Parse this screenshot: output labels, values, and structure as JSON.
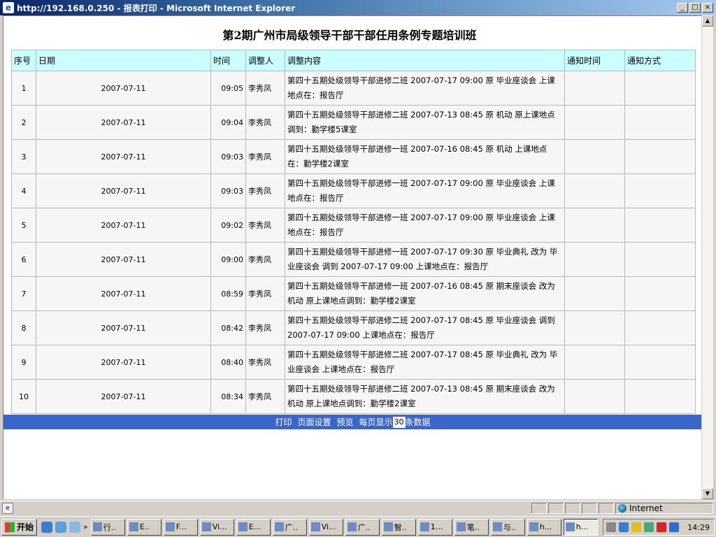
{
  "window": {
    "title": "http://192.168.0.250 - 报表打印 - Microsoft Internet Explorer",
    "min_glyph": "_",
    "max_glyph": "□",
    "close_glyph": "×"
  },
  "report": {
    "title": "第2期广州市局级领导干部干部任用条例专题培训班",
    "columns": [
      "序号",
      "日期",
      "时间",
      "调整人",
      "调整内容",
      "通知时间",
      "通知方式"
    ],
    "rows": [
      {
        "no": "1",
        "date": "2007-07-11",
        "time": "09:05",
        "person": "李秀凤",
        "content": "第四十五期处级领导干部进修二班 2007-07-17 09:00 原 毕业座谈会 上课地点在：报告厅",
        "notify_time": "",
        "notify_method": ""
      },
      {
        "no": "2",
        "date": "2007-07-11",
        "time": "09:04",
        "person": "李秀凤",
        "content": "第四十五期处级领导干部进修二班 2007-07-13 08:45 原 机动 原上课地点调到：勤学楼5课室",
        "notify_time": "",
        "notify_method": ""
      },
      {
        "no": "3",
        "date": "2007-07-11",
        "time": "09:03",
        "person": "李秀凤",
        "content": "第四十五期处级领导干部进修一班 2007-07-16 08:45 原 机动 上课地点在：勤学楼2课室",
        "notify_time": "",
        "notify_method": ""
      },
      {
        "no": "4",
        "date": "2007-07-11",
        "time": "09:03",
        "person": "李秀凤",
        "content": "第四十五期处级领导干部进修一班 2007-07-17 09:00 原 毕业座谈会 上课地点在：报告厅",
        "notify_time": "",
        "notify_method": ""
      },
      {
        "no": "5",
        "date": "2007-07-11",
        "time": "09:02",
        "person": "李秀凤",
        "content": "第四十五期处级领导干部进修一班 2007-07-17 09:00 原 毕业座谈会 上课地点在：报告厅",
        "notify_time": "",
        "notify_method": ""
      },
      {
        "no": "6",
        "date": "2007-07-11",
        "time": "09:00",
        "person": "李秀凤",
        "content": "第四十五期处级领导干部进修一班 2007-07-17 09:30 原 毕业典礼 改为 毕业座谈会 调到 2007-07-17 09:00 上课地点在：报告厅",
        "notify_time": "",
        "notify_method": ""
      },
      {
        "no": "7",
        "date": "2007-07-11",
        "time": "08:59",
        "person": "李秀凤",
        "content": "第四十五期处级领导干部进修一班 2007-07-16 08:45 原 期末座谈会 改为 机动 原上课地点调到：勤学楼2课室",
        "notify_time": "",
        "notify_method": ""
      },
      {
        "no": "8",
        "date": "2007-07-11",
        "time": "08:42",
        "person": "李秀凤",
        "content": "第四十五期处级领导干部进修二班 2007-07-17 08:45 原 毕业座谈会 调到 2007-07-17 09:00 上课地点在：报告厅",
        "notify_time": "",
        "notify_method": ""
      },
      {
        "no": "9",
        "date": "2007-07-11",
        "time": "08:40",
        "person": "李秀凤",
        "content": "第四十五期处级领导干部进修二班 2007-07-17 08:45 原 毕业典礼 改为 毕业座谈会 上课地点在：报告厅",
        "notify_time": "",
        "notify_method": ""
      },
      {
        "no": "10",
        "date": "2007-07-11",
        "time": "08:34",
        "person": "李秀凤",
        "content": "第四十五期处级领导干部进修二班 2007-07-13 08:45 原 期末座谈会 改为 机动 原上课地点调到：勤学楼2课室",
        "notify_time": "",
        "notify_method": ""
      }
    ]
  },
  "toolbar": {
    "print": "打印",
    "page_setup": "页面设置",
    "preview": "预览",
    "per_page_prefix": "每页显示",
    "per_page_value": "30",
    "per_page_suffix": "条数据"
  },
  "statusbar": {
    "zone": "Internet"
  },
  "taskbar": {
    "start": "开始",
    "chevron": "»",
    "tasks": [
      "行..",
      "E..",
      "F...",
      "Vi...",
      "E...",
      "广..",
      "Vi...",
      "广..",
      "智..",
      "1...",
      "笔..",
      "与..",
      "h...",
      "h..."
    ],
    "clock": "14:29"
  },
  "colors": {
    "header_bg": "#ccffff",
    "toolbar_bg": "#3a66cc",
    "titlebar_start": "#0a246a"
  }
}
